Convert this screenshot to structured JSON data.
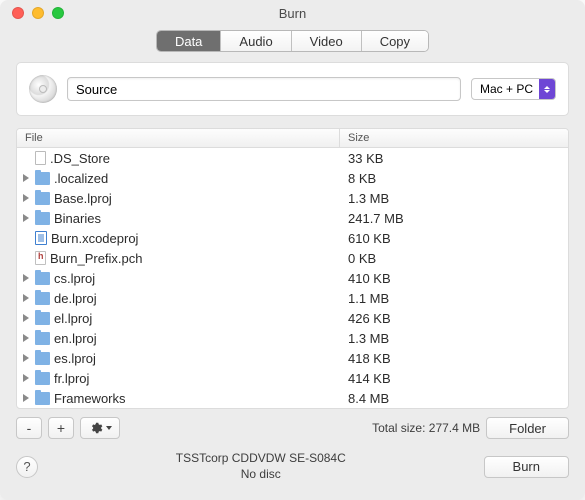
{
  "window": {
    "title": "Burn"
  },
  "tabs": {
    "data": "Data",
    "audio": "Audio",
    "video": "Video",
    "copy": "Copy",
    "active": "data"
  },
  "source": {
    "value": "Source"
  },
  "format_select": {
    "selected": "Mac + PC"
  },
  "columns": {
    "file": "File",
    "size": "Size"
  },
  "rows": [
    {
      "name": ".DS_Store",
      "size": "33 KB",
      "expandable": false,
      "icon": "file"
    },
    {
      "name": ".localized",
      "size": "8 KB",
      "expandable": true,
      "icon": "folder"
    },
    {
      "name": "Base.lproj",
      "size": "1.3 MB",
      "expandable": true,
      "icon": "folder"
    },
    {
      "name": "Binaries",
      "size": "241.7 MB",
      "expandable": true,
      "icon": "folder"
    },
    {
      "name": "Burn.xcodeproj",
      "size": "610 KB",
      "expandable": false,
      "icon": "xcode"
    },
    {
      "name": "Burn_Prefix.pch",
      "size": "0 KB",
      "expandable": false,
      "icon": "pch"
    },
    {
      "name": "cs.lproj",
      "size": "410 KB",
      "expandable": true,
      "icon": "folder"
    },
    {
      "name": "de.lproj",
      "size": "1.1 MB",
      "expandable": true,
      "icon": "folder"
    },
    {
      "name": "el.lproj",
      "size": "426 KB",
      "expandable": true,
      "icon": "folder"
    },
    {
      "name": "en.lproj",
      "size": "1.3 MB",
      "expandable": true,
      "icon": "folder"
    },
    {
      "name": "es.lproj",
      "size": "418 KB",
      "expandable": true,
      "icon": "folder"
    },
    {
      "name": "fr.lproj",
      "size": "414 KB",
      "expandable": true,
      "icon": "folder"
    },
    {
      "name": "Frameworks",
      "size": "8.4 MB",
      "expandable": true,
      "icon": "folder"
    }
  ],
  "buttons": {
    "remove": "-",
    "add": "+",
    "help": "?",
    "folder": "Folder",
    "burn": "Burn"
  },
  "summary": {
    "total_label": "Total size:",
    "total_value": "277.4 MB"
  },
  "device": {
    "name": "TSSTcorp CDDVDW SE-S084C",
    "status": "No disc"
  }
}
